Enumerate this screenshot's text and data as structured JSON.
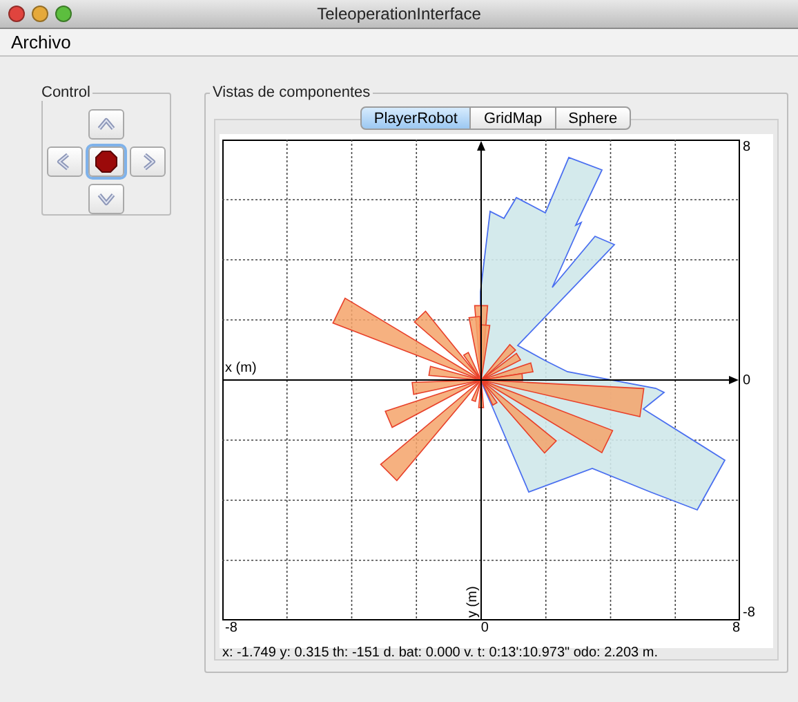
{
  "window": {
    "title": "TeleoperationInterface"
  },
  "menu": [
    "Archivo"
  ],
  "control": {
    "title": "Control",
    "buttons": [
      {
        "kind": "up",
        "focused": false
      },
      {
        "kind": "left",
        "focused": false
      },
      {
        "kind": "stop",
        "focused": true
      },
      {
        "kind": "right",
        "focused": false
      },
      {
        "kind": "down",
        "focused": false
      }
    ]
  },
  "views": {
    "title": "Vistas de componentes",
    "tabs": [
      {
        "label": "PlayerRobot",
        "selected": true
      },
      {
        "label": "GridMap",
        "selected": false
      },
      {
        "label": "Sphere",
        "selected": false
      }
    ],
    "plot": {
      "x_label": "x (m)",
      "y_label": "y (m)",
      "right_ticks": [
        "8",
        "0",
        "-8"
      ],
      "bottom_ticks": [
        "-8",
        "0",
        "8"
      ]
    },
    "status": "x: -1.749 y: 0.315 th: -151 d. bat: 0.000 v. t: 0:13':10.973\" odo: 2.203 m."
  }
}
